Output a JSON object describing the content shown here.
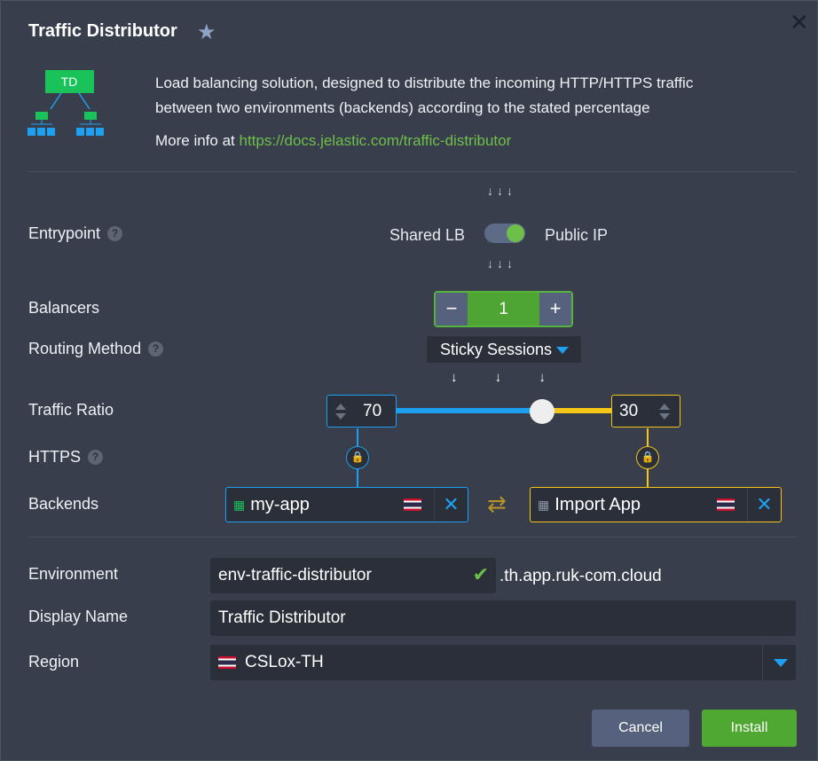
{
  "header": {
    "title": "Traffic Distributor",
    "star_icon": "star-icon",
    "close_icon": "close-icon"
  },
  "info": {
    "logo_text": "TD",
    "description_line1": "Load balancing solution, designed to distribute the incoming HTTP/HTTPS traffic",
    "description_line2": "between two environments (backends) according to the stated percentage",
    "more_prefix": "More info at",
    "more_link": "https://docs.jelastic.com/traffic-distributor"
  },
  "entrypoint": {
    "label": "Entrypoint",
    "left": "Shared LB",
    "right": "Public IP"
  },
  "balancers": {
    "label": "Balancers",
    "minus": "−",
    "value": "1",
    "plus": "+"
  },
  "routing": {
    "label": "Routing Method",
    "value": "Sticky Sessions"
  },
  "ratio": {
    "label": "Traffic Ratio",
    "left": "70",
    "right": "30"
  },
  "https": {
    "label": "HTTPS"
  },
  "backends": {
    "label": "Backends",
    "left": {
      "name": "my-app"
    },
    "right": {
      "name": "Import App"
    },
    "swap_glyph": "⇄",
    "remove_glyph": "✕"
  },
  "form": {
    "environment_label": "Environment",
    "environment_value": "env-traffic-distributor",
    "domain_suffix": ".th.app.ruk-com.cloud",
    "display_label": "Display Name",
    "display_value": "Traffic Distributor",
    "region_label": "Region",
    "region_value": "CSLox-TH"
  },
  "buttons": {
    "cancel": "Cancel",
    "install": "Install"
  },
  "colors": {
    "accent_blue": "#1ea0f0",
    "accent_yellow": "#f5c518",
    "green": "#58b33c",
    "link": "#6fbf4a"
  }
}
